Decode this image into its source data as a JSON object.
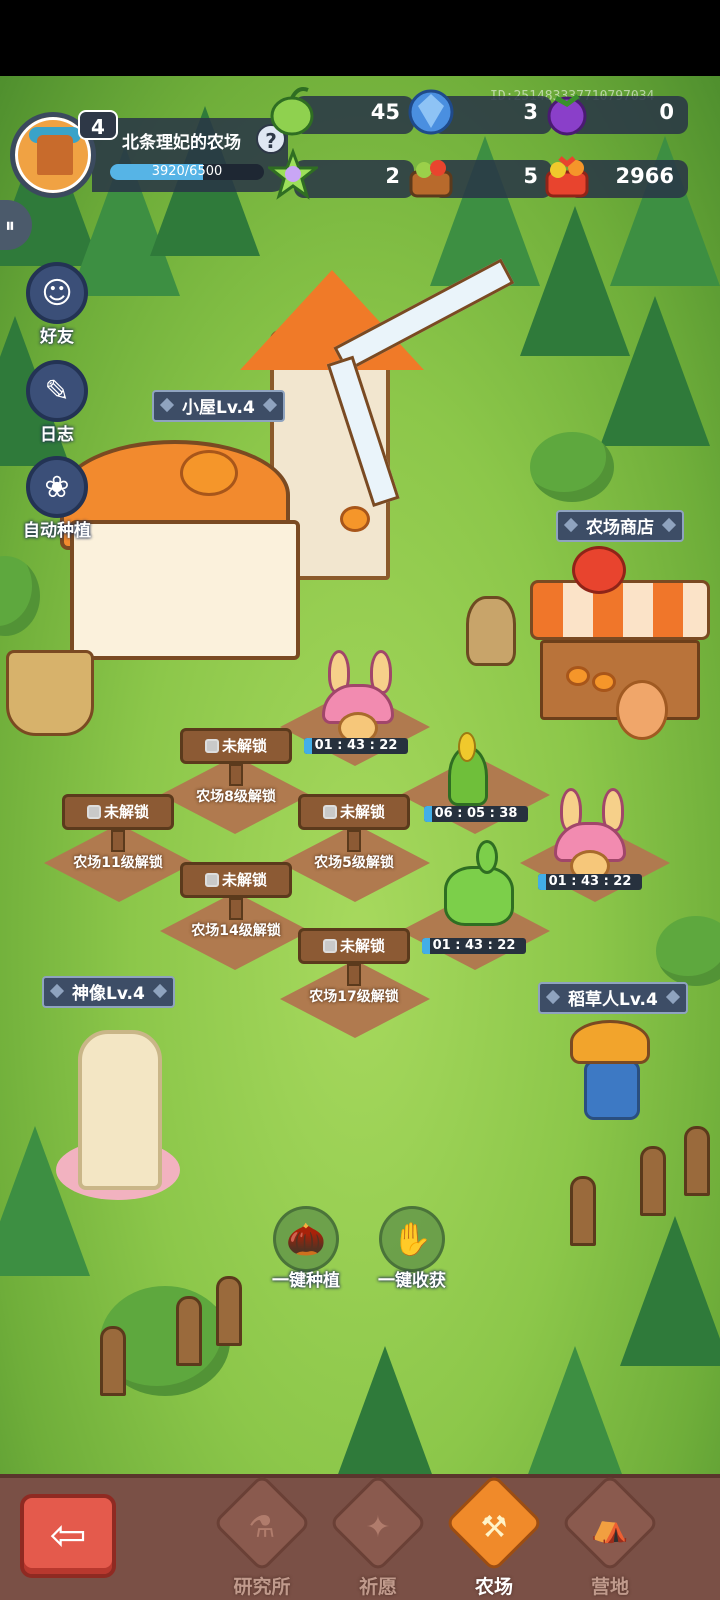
{
  "player": {
    "level": "4",
    "farm_name": "北条理妃的农场",
    "help": "?",
    "xp_text": "3920/6500",
    "xp_fraction": 0.603
  },
  "player_id": "ID:251483337710797034",
  "resources": [
    {
      "icon": "green-bean-icon",
      "value": "45"
    },
    {
      "icon": "blue-crystal-icon",
      "value": "3"
    },
    {
      "icon": "purple-berry-icon",
      "value": "0"
    },
    {
      "icon": "star-gem-icon",
      "value": "2"
    },
    {
      "icon": "vegetable-basket-icon",
      "value": "5"
    },
    {
      "icon": "fruit-basket-icon",
      "value": "2966"
    }
  ],
  "side_menu": [
    {
      "label": "好友",
      "icon": "friends-icon"
    },
    {
      "label": "日志",
      "icon": "journal-icon"
    },
    {
      "label": "自动种植",
      "icon": "auto-plant-icon"
    }
  ],
  "buildings": {
    "house": "小屋Lv.4",
    "shop": "农场商店",
    "statue": "神像Lv.4",
    "scarecrow": "稻草人Lv.4"
  },
  "plots": {
    "active": [
      {
        "crop": "mushroom-bunny",
        "timer": "01 : 43 : 22"
      },
      {
        "crop": "corn-sprout",
        "timer": "06 : 05 : 38"
      },
      {
        "crop": "mushroom-bunny",
        "timer": "01 : 43 : 22"
      },
      {
        "crop": "cactus-cat",
        "timer": "01 : 43 : 22"
      }
    ],
    "locked": [
      {
        "label": "未解锁",
        "requirement": "农场8级解锁"
      },
      {
        "label": "未解锁",
        "requirement": "农场11级解锁"
      },
      {
        "label": "未解锁",
        "requirement": "农场5级解锁"
      },
      {
        "label": "未解锁",
        "requirement": "农场14级解锁"
      },
      {
        "label": "未解锁",
        "requirement": "农场17级解锁"
      }
    ]
  },
  "actions": {
    "plant_all": "一键种植",
    "harvest_all": "一键收获"
  },
  "nav": {
    "tabs": [
      {
        "label": "研究所",
        "icon": "research-icon",
        "active": false
      },
      {
        "label": "祈愿",
        "icon": "wish-icon",
        "active": false
      },
      {
        "label": "农场",
        "icon": "farm-icon",
        "active": true
      },
      {
        "label": "营地",
        "icon": "camp-icon",
        "active": false
      }
    ]
  }
}
